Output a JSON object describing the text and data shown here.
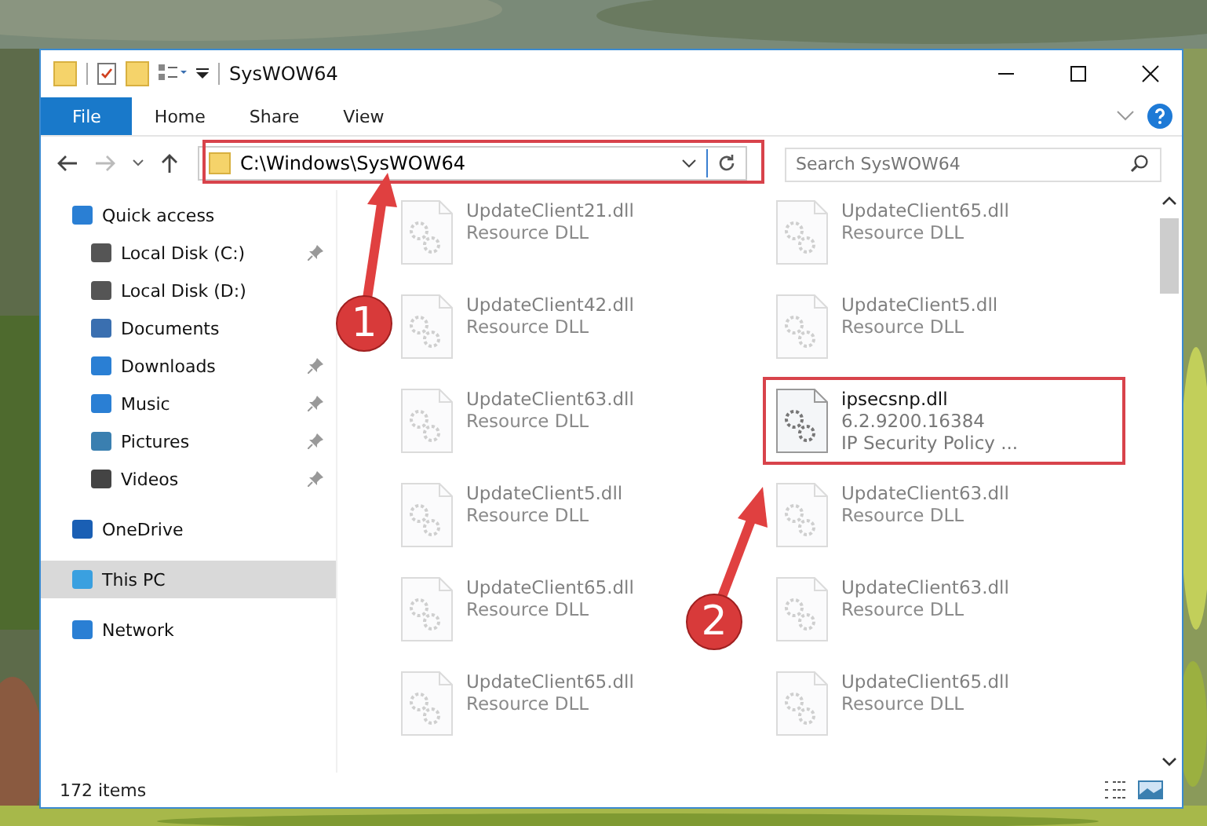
{
  "window": {
    "title": "SysWOW64"
  },
  "ribbon_tabs": [
    {
      "label": "File",
      "selected": true
    },
    {
      "label": "Home",
      "selected": false
    },
    {
      "label": "Share",
      "selected": false
    },
    {
      "label": "View",
      "selected": false
    }
  ],
  "address": {
    "path": "C:\\Windows\\SysWOW64"
  },
  "search": {
    "placeholder": "Search SysWOW64"
  },
  "sidebar": {
    "items": [
      {
        "label": "Quick access",
        "kind": "star",
        "selected": false,
        "children": [
          {
            "label": "Local Disk (C:)",
            "kind": "disk",
            "pinned": true
          },
          {
            "label": "Local Disk (D:)",
            "kind": "disk",
            "pinned": false
          },
          {
            "label": "Documents",
            "kind": "doc",
            "pinned": false
          },
          {
            "label": "Downloads",
            "kind": "download",
            "pinned": true
          },
          {
            "label": "Music",
            "kind": "music",
            "pinned": true
          },
          {
            "label": "Pictures",
            "kind": "pictures",
            "pinned": true
          },
          {
            "label": "Videos",
            "kind": "videos",
            "pinned": true
          }
        ]
      },
      {
        "label": "OneDrive",
        "kind": "cloud",
        "selected": false
      },
      {
        "label": "This PC",
        "kind": "pc",
        "selected": true
      },
      {
        "label": "Network",
        "kind": "network",
        "selected": false
      }
    ]
  },
  "files": [
    {
      "name": "UpdateClient21.dll",
      "details": [
        "Resource DLL"
      ],
      "selected": false
    },
    {
      "name": "UpdateClient65.dll",
      "details": [
        "Resource DLL"
      ],
      "selected": false
    },
    {
      "name": "UpdateClient42.dll",
      "details": [
        "Resource DLL"
      ],
      "selected": false
    },
    {
      "name": "UpdateClient5.dll",
      "details": [
        "Resource DLL"
      ],
      "selected": false
    },
    {
      "name": "UpdateClient63.dll",
      "details": [
        "Resource DLL"
      ],
      "selected": false
    },
    {
      "name": "ipsecsnp.dll",
      "details": [
        "6.2.9200.16384",
        "IP Security Policy ..."
      ],
      "selected": true
    },
    {
      "name": "UpdateClient5.dll",
      "details": [
        "Resource DLL"
      ],
      "selected": false
    },
    {
      "name": "UpdateClient63.dll",
      "details": [
        "Resource DLL"
      ],
      "selected": false
    },
    {
      "name": "UpdateClient65.dll",
      "details": [
        "Resource DLL"
      ],
      "selected": false
    },
    {
      "name": "UpdateClient63.dll",
      "details": [
        "Resource DLL"
      ],
      "selected": false
    },
    {
      "name": "UpdateClient65.dll",
      "details": [
        "Resource DLL"
      ],
      "selected": false
    },
    {
      "name": "UpdateClient65.dll",
      "details": [
        "Resource DLL"
      ],
      "selected": false
    }
  ],
  "status_bar": {
    "count": "172 items"
  },
  "callouts": [
    {
      "number": "1"
    },
    {
      "number": "2"
    }
  ]
}
